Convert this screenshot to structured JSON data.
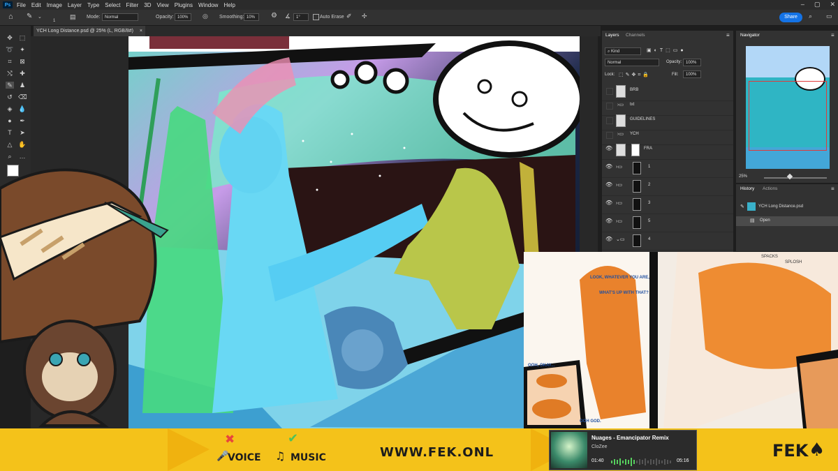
{
  "app": {
    "logo": "Ps"
  },
  "menu": {
    "items": [
      "File",
      "Edit",
      "Image",
      "Layer",
      "Type",
      "Select",
      "Filter",
      "3D",
      "View",
      "Plugins",
      "Window",
      "Help"
    ]
  },
  "options_bar": {
    "mode_label": "Mode:",
    "mode_value": "Normal",
    "opacity_label": "Opacity:",
    "opacity_value": "100%",
    "smoothing_label": "Smoothing:",
    "smoothing_value": "10%",
    "angle_value": "1°",
    "auto_erase_label": "Auto Erase",
    "brush_size": "1",
    "share_label": "Share"
  },
  "document": {
    "tab_title": "YCH Long Distance.psd @ 25% (L, RGB/8#)",
    "tab_close": "×"
  },
  "layers_panel": {
    "tabs": [
      "Layers",
      "Channels"
    ],
    "filter_value": "Kind",
    "blend_mode": "Normal",
    "opacity_label": "Opacity:",
    "opacity_value": "100%",
    "lock_label": "Lock:",
    "fill_label": "Fill:",
    "fill_value": "100%",
    "layers": [
      {
        "name": "BRB",
        "visible": false,
        "type": "layer"
      },
      {
        "name": "txt",
        "visible": false,
        "type": "group"
      },
      {
        "name": "GUIDELINES",
        "visible": false,
        "type": "layer"
      },
      {
        "name": "YCH",
        "visible": false,
        "type": "group"
      },
      {
        "name": "FRA",
        "visible": true,
        "type": "layer"
      },
      {
        "name": "1",
        "visible": true,
        "type": "group"
      },
      {
        "name": "2",
        "visible": true,
        "type": "group"
      },
      {
        "name": "3",
        "visible": true,
        "type": "group"
      },
      {
        "name": "5",
        "visible": true,
        "type": "group"
      },
      {
        "name": "4",
        "visible": true,
        "type": "group"
      }
    ]
  },
  "navigator_panel": {
    "title": "Navigator",
    "zoom": "25%"
  },
  "history_panel": {
    "tabs": [
      "History",
      "Actions"
    ],
    "snapshot": "YCH Long Distance.psd",
    "items": [
      "Open"
    ]
  },
  "comic_inset": {
    "speech_1": "LOOK, WHATEVER YOU ARE,",
    "speech_2": "WHAT'S UP WITH THAT?",
    "caption_1": "OOH, OKAY...",
    "caption_2": "OOH GOD.",
    "sfx": "SPACKS",
    "sfx_2": "SPLOSH"
  },
  "stream_overlay": {
    "voice_label": "VOICE",
    "music_label": "MUSIC",
    "website": "WWW.FEK.ONL",
    "brand": "FEK"
  },
  "now_playing": {
    "title": "Nuages - Emancipator Remix",
    "artist": "CloZee",
    "elapsed": "01:40",
    "total": "05:16"
  },
  "colors": {
    "accent": "#1473e6",
    "overlay_yellow": "#f4c21a",
    "voice_x": "#e8453c",
    "music_check": "#4fc15a",
    "music_wave": "#57d05e"
  }
}
